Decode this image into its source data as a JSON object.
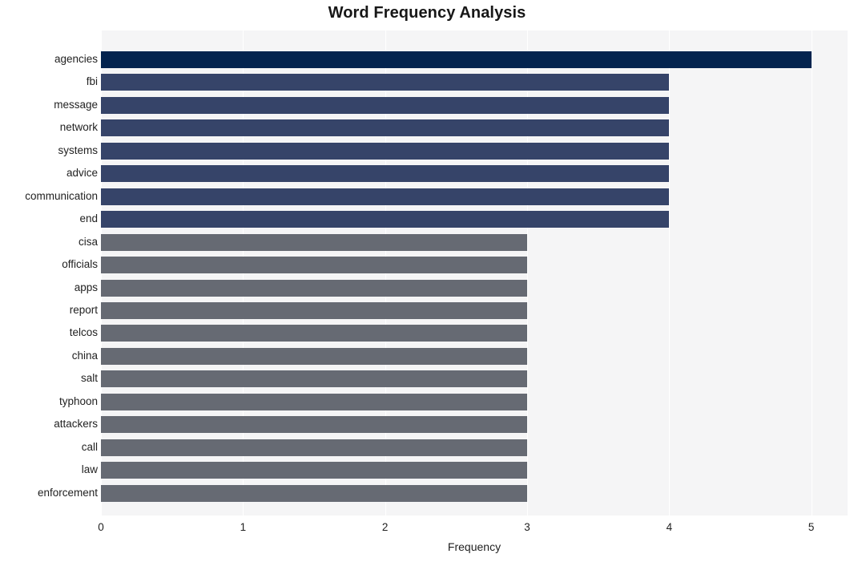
{
  "chart_data": {
    "type": "bar",
    "orientation": "horizontal",
    "title": "Word Frequency Analysis",
    "xlabel": "Frequency",
    "ylabel": "",
    "xlim": [
      0,
      5
    ],
    "xticks": [
      0,
      1,
      2,
      3,
      4,
      5
    ],
    "xticklabels": [
      "0",
      "1",
      "2",
      "3",
      "4",
      "5"
    ],
    "grid": "vertical-white-gridlines",
    "legend": "none",
    "categories": [
      "agencies",
      "fbi",
      "message",
      "network",
      "systems",
      "advice",
      "communication",
      "end",
      "cisa",
      "officials",
      "apps",
      "report",
      "telcos",
      "china",
      "salt",
      "typhoon",
      "attackers",
      "call",
      "law",
      "enforcement"
    ],
    "values": [
      5,
      4,
      4,
      4,
      4,
      4,
      4,
      4,
      3,
      3,
      3,
      3,
      3,
      3,
      3,
      3,
      3,
      3,
      3,
      3
    ],
    "bar_colors": [
      "#04244f",
      "#364469",
      "#364469",
      "#364469",
      "#364469",
      "#364469",
      "#364469",
      "#364469",
      "#666a73",
      "#666a73",
      "#666a73",
      "#666a73",
      "#666a73",
      "#666a73",
      "#666a73",
      "#666a73",
      "#666a73",
      "#666a73",
      "#666a73",
      "#666a73"
    ]
  },
  "style": {
    "plot_background": "#f5f5f6",
    "figure_background": "#ffffff",
    "gridline_color": "#ffffff",
    "text_color": "#222222",
    "title_color": "#171717"
  }
}
